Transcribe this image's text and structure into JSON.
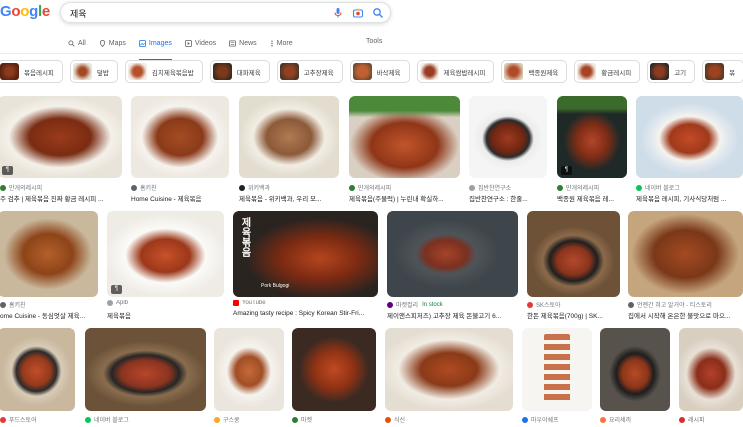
{
  "search": {
    "query": "제육"
  },
  "tabs": [
    {
      "label": "All",
      "icon": "search-icon"
    },
    {
      "label": "Maps",
      "icon": "map-pin-icon"
    },
    {
      "label": "Images",
      "icon": "image-icon",
      "active": true
    },
    {
      "label": "Videos",
      "icon": "video-icon"
    },
    {
      "label": "News",
      "icon": "news-icon"
    },
    {
      "label": "More",
      "icon": "more-icon"
    }
  ],
  "tools_label": "Tools",
  "chips": [
    {
      "label": "볶음레시피",
      "color": "#8b3a1e"
    },
    {
      "label": "덮밥",
      "color": "#a14a22"
    },
    {
      "label": "김치제육볶음밥",
      "color": "#b5502a"
    },
    {
      "label": "대파제육",
      "color": "#7a3a1a"
    },
    {
      "label": "고추장제육",
      "color": "#934020"
    },
    {
      "label": "바삭제육",
      "color": "#c06030"
    },
    {
      "label": "제육쌈밥레시피",
      "color": "#9a3c22"
    },
    {
      "label": "백종원제육",
      "color": "#b04a28"
    },
    {
      "label": "황금레시피",
      "color": "#a84424"
    },
    {
      "label": "고기",
      "color": "#8c3a20"
    },
    {
      "label": "볶",
      "color": "#9e4222"
    }
  ],
  "results": [
    {
      "source": "만개의레시피",
      "title": "주 검추 | 제육볶음 진짜 황금 레시피 ...",
      "fav": "#2e7d32",
      "badge": true
    },
    {
      "source": "홈키친",
      "title": "Home Cuisine - 제육볶음",
      "fav": "#5f6368"
    },
    {
      "source": "위키백과",
      "title": "제육볶음 - 위키백과, 우리 모...",
      "fav": "#202124"
    },
    {
      "source": "만개의레시피",
      "title": "제육볶음(주물럭) | 누린내 확실하...",
      "fav": "#2e7d32"
    },
    {
      "source": "집반찬연구소",
      "title": "집반찬연구소 : 한줄...",
      "fav": "#9aa0a6"
    },
    {
      "source": "만개의레시피",
      "title": "백종원 제육볶음 레...",
      "fav": "#2e7d32",
      "badge": true
    },
    {
      "source": "네이버 블로그",
      "title": "제육볶음 레시피, 기사식당처럼 ...",
      "fav": "#03c75a"
    },
    {
      "source": "홈키친",
      "title": "ome Cuisine - 동심엇살 제육...",
      "fav": "#5f6368"
    },
    {
      "source": "Aplb",
      "title": "제육볶음",
      "fav": "#9aa0a6",
      "badge": true
    },
    {
      "source": "YouTube",
      "title": "Amazing tasty recipe : Spicy Korean Stir-Fri...",
      "fav": "#ff0000",
      "overlay": "제육볶음",
      "tag": "Pork Bulgogi"
    },
    {
      "source": "마켓컬리",
      "title": "제이앤스피저즈) 고추장 제육 돈불고기 6...",
      "fav": "#5f0080",
      "in_stock": "In stock"
    },
    {
      "source": "SK스토아",
      "title": "한돈 제육볶음(700g) | SK...",
      "fav": "#e53935"
    },
    {
      "source": "언젠간 혀고 알거야 - 티스토리",
      "title": "집에서 시작해 온은한 불맛으로 마으...",
      "fav": "#5f6368"
    },
    {
      "source": "푸드스토어",
      "title": "",
      "fav": "#e53935"
    },
    {
      "source": "네이버 블로그",
      "title": "",
      "fav": "#03c75a"
    },
    {
      "source": "구스쿵",
      "title": "",
      "fav": "#f9a825"
    },
    {
      "source": "마켓",
      "title": "",
      "fav": "#2e7d32"
    },
    {
      "source": "식신",
      "title": "",
      "fav": "#e65100"
    },
    {
      "source": "마우이쉐프",
      "title": "",
      "fav": "#1a73e8"
    },
    {
      "source": "요리세끼",
      "title": "",
      "fav": "#ff7043"
    },
    {
      "source": "레시피",
      "title": "",
      "fav": "#d32f2f"
    }
  ],
  "colors": {
    "accent": "#1a73e8",
    "meat": "#9b3a1c",
    "plate": "#f2efe9"
  }
}
